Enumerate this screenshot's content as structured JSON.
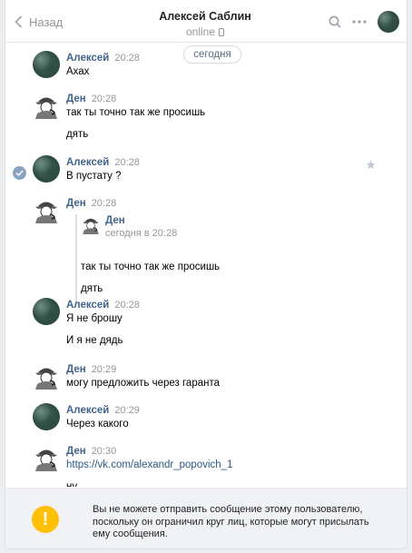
{
  "header": {
    "back_label": "Назад",
    "contact_name": "Алексей Саблин",
    "status": "online"
  },
  "date_separator": "сегодня",
  "messages": [
    {
      "author": "Алексей",
      "time": "20:28",
      "lines": [
        "Ахах"
      ]
    },
    {
      "author": "Ден",
      "time": "20:28",
      "lines": [
        "так ты точно так же просишь",
        "дять"
      ]
    },
    {
      "author": "Алексей",
      "time": "20:28",
      "lines": [
        "В пустату ?"
      ]
    },
    {
      "author": "Ден",
      "time": "20:28",
      "forwarded": {
        "author": "Ден",
        "time": "сегодня в 20:28",
        "lines": [
          "так ты точно так же просишь",
          "дять"
        ]
      }
    },
    {
      "author": "Алексей",
      "time": "20:28",
      "lines": [
        "Я не брошу",
        "И я не дядь"
      ]
    },
    {
      "author": "Ден",
      "time": "20:29",
      "lines": [
        "могу предложить через гаранта"
      ]
    },
    {
      "author": "Алексей",
      "time": "20:29",
      "lines": [
        "Через какого"
      ]
    },
    {
      "author": "Ден",
      "time": "20:30",
      "lines": [
        "https://vk.com/alexandr_popovich_1",
        "ну"
      ]
    }
  ],
  "footer": {
    "warning_text": "Вы не можете отправить сообщение этому пользователю, поскольку он ограничил круг лиц, которые могут присылать ему сообщения."
  },
  "colors": {
    "link": "#2a5885",
    "name": "#42648b",
    "warning": "#ffc107"
  }
}
